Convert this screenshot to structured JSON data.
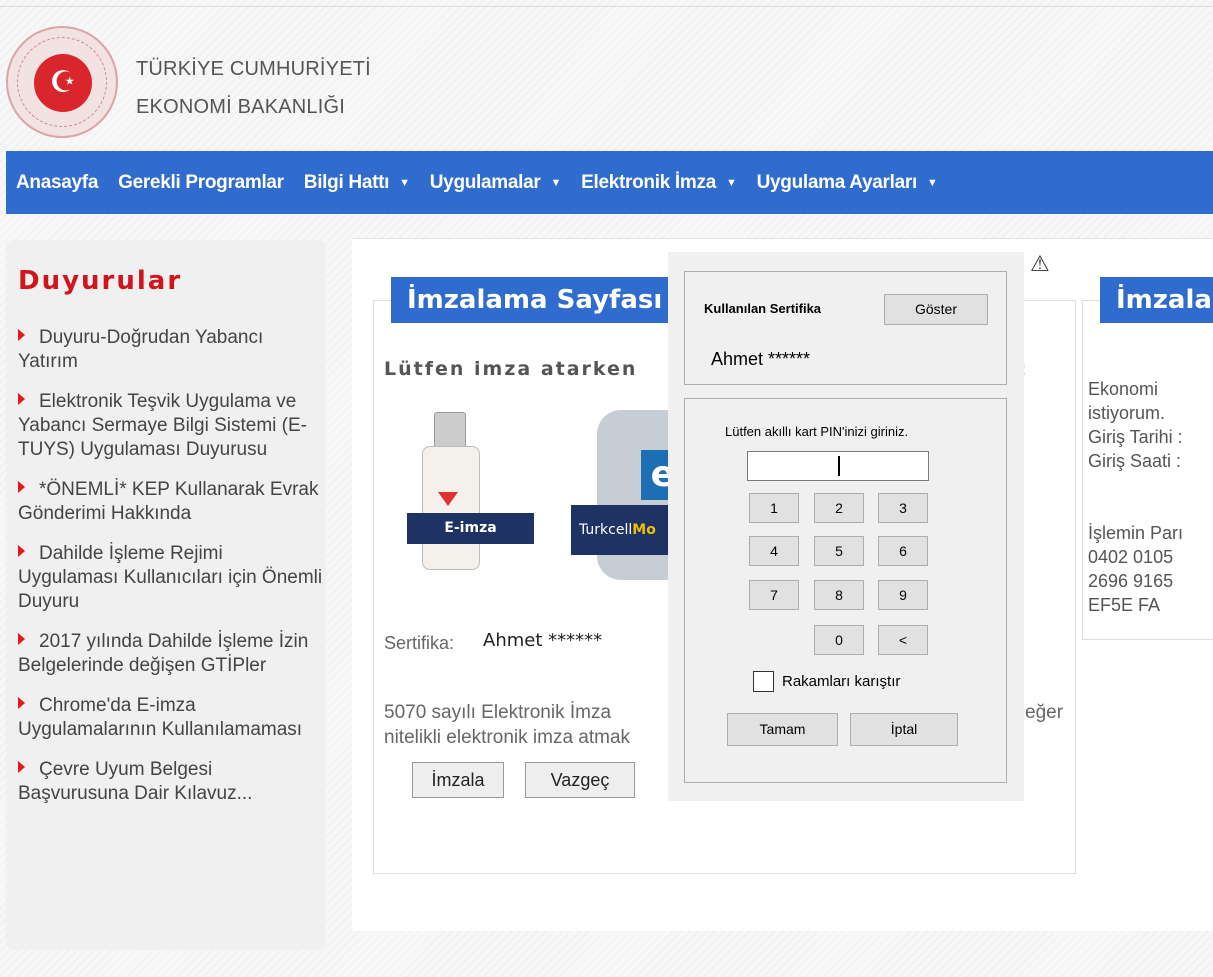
{
  "header": {
    "line1": "TÜRKİYE CUMHURİYETİ",
    "line2": "EKONOMİ BAKANLIĞI"
  },
  "nav": [
    {
      "label": "Anasayfa",
      "caret": false
    },
    {
      "label": "Gerekli Programlar",
      "caret": false
    },
    {
      "label": "Bilgi Hattı",
      "caret": true
    },
    {
      "label": "Uygulamalar",
      "caret": true
    },
    {
      "label": "Elektronik İmza",
      "caret": true
    },
    {
      "label": "Uygulama Ayarları",
      "caret": true
    }
  ],
  "sidebar": {
    "title": "Duyurular",
    "items": [
      "Duyuru-Doğrudan Yabancı Yatırım",
      "Elektronik Teşvik Uygulama ve Yabancı Sermaye Bilgi Sistemi (E-TUYS) Uygulaması Duyurusu",
      "*ÖNEMLİ* KEP Kullanarak Evrak Gönderimi Hakkında",
      "Dahilde İşleme Rejimi Uygulaması Kullanıcıları için Önemli Duyuru",
      "2017 yılında Dahilde İşleme İzin Belgelerinde değişen GTİPler",
      "Chrome'da E-imza Uygulamalarının Kullanılamaması",
      "Çevre Uyum Belgesi Başvurusuna Dair Kılavuz..."
    ]
  },
  "main": {
    "title": "İmzalama Sayfası",
    "instruction": "Lütfen imza atarken",
    "colon": ":",
    "eimza_tag": "E-imza",
    "turkcell_a": "Turkcell",
    "turkcell_b": "Mo",
    "phone_glyph": "e",
    "cert_label": "Sertifika:",
    "cert_value": "Ahmet ******",
    "law_line1": "5070 sayılı Elektronik İmza",
    "law_line2": "nitelikli elektronik imza atmak",
    "law_line3": "eğer",
    "sign_button": "İmzala",
    "cancel_button": "Vazgeç",
    "warning_glyph": "⚠"
  },
  "right": {
    "title": "İmzala",
    "lines": [
      "Ekonomi",
      "istiyorum.",
      "Giriş Tarihi :",
      "Giriş Saati :",
      "",
      "İşlemin Parı",
      "0402 0105",
      "2696 9165",
      "EF5E FA"
    ]
  },
  "dialog": {
    "cert_title": "Kullanılan Sertifika",
    "show_button": "Göster",
    "cert_name": "Ahmet ******",
    "pin_label": "Lütfen akıllı kart PIN'inizi giriniz.",
    "pin_value": "",
    "keys": [
      "1",
      "2",
      "3",
      "4",
      "5",
      "6",
      "7",
      "8",
      "9",
      "0",
      "<"
    ],
    "shuffle_label": "Rakamları karıştır",
    "shuffle_checked": false,
    "ok_button": "Tamam",
    "cancel_button": "İptal"
  },
  "colors": {
    "nav_blue": "#2f6ccd",
    "title_red": "#d0161c",
    "bullet_red": "#e5171d",
    "tag_navy": "#1f3264"
  }
}
